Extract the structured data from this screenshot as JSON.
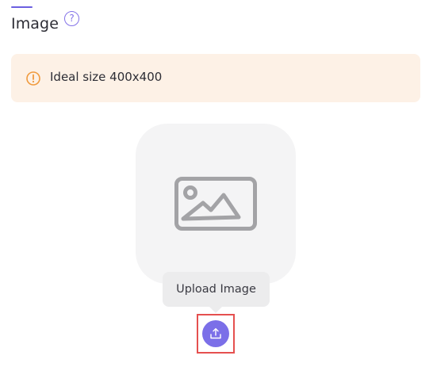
{
  "section": {
    "title": "Image",
    "help_icon": "question-circle-icon",
    "help_symbol": "?"
  },
  "alert": {
    "icon": "exclamation-circle-icon",
    "text": "Ideal size 400x400",
    "background": "#fdf1e6",
    "icon_color": "#f09a3e"
  },
  "preview": {
    "icon": "image-placeholder-icon"
  },
  "tooltip": {
    "text": "Upload Image"
  },
  "upload_button": {
    "icon": "upload-icon",
    "color": "#7b6fe8"
  },
  "colors": {
    "accent": "#6b5fe0",
    "highlight": "#e5504f"
  }
}
